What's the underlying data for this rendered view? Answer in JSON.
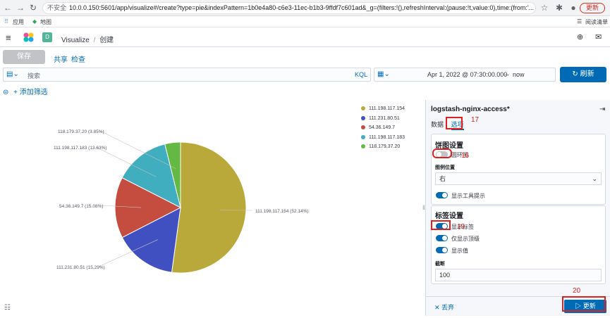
{
  "browser": {
    "insecure_label": "不安全",
    "url": "10.0.0.150:5601/app/visualize#/create?type=pie&indexPattern=1b0e4a80-c6e3-11ec-b1b3-9ffdf7c601ad&_g=(filters:!(),refreshInterval:(pause:!t,value:0),time:(from:'...",
    "update_label": "更新",
    "bookmarks": {
      "apps": "应用",
      "maps": "地图",
      "reading_list": "阅读清单"
    }
  },
  "header": {
    "space_letter": "D",
    "breadcrumb_root": "Visualize",
    "breadcrumb_current": "创建"
  },
  "toolbar": {
    "save_label": "保存",
    "share_label": "共享",
    "inspect_label": "检查"
  },
  "query": {
    "placeholder": "搜索",
    "language": "KQL",
    "date_from": "Apr 1, 2022 @ 07:30:00.000",
    "arrow": "→",
    "date_to": "now",
    "refresh_label": "刷新",
    "add_filter_label": "+ 添加筛选"
  },
  "chart_data": {
    "type": "pie",
    "slices": [
      {
        "name": "111.198.117.154",
        "value": 52.14,
        "label": "111.198.117.154 (52.14%)",
        "color": "#b9a93a"
      },
      {
        "name": "111.231.80.51",
        "value": 15.29,
        "label": "111.231.80.51 (15.29%)",
        "color": "#4150c1"
      },
      {
        "name": "54.36.149.7",
        "value": 15.08,
        "label": "54.36.149.7 (15.08%)",
        "color": "#c44d3f"
      },
      {
        "name": "111.198.117.183",
        "value": 13.63,
        "label": "111.198.117.183 (13.63%)",
        "color": "#40aebe"
      },
      {
        "name": "118.179.37.20",
        "value": 3.85,
        "label": "118.179.37.20 (3.85%)",
        "color": "#64b945"
      }
    ],
    "legend_position": "top-right"
  },
  "panel": {
    "title": "logstash-nginx-access*",
    "tabs": [
      "数据",
      "选项"
    ],
    "pie_settings_title": "饼图设置",
    "donut_label": "圆环图",
    "legend_position_label": "图例位置",
    "legend_position_value": "右",
    "show_tooltip_label": "显示工具提示",
    "label_settings_title": "标签设置",
    "show_labels_label": "显示标签",
    "top_level_only_label": "仅显示顶级",
    "show_values_label": "显示值",
    "truncate_label": "截断",
    "truncate_value": "100",
    "discard_label": "丢弃",
    "update_label": "更新"
  },
  "annotations": [
    "16",
    "17",
    "19",
    "20"
  ]
}
